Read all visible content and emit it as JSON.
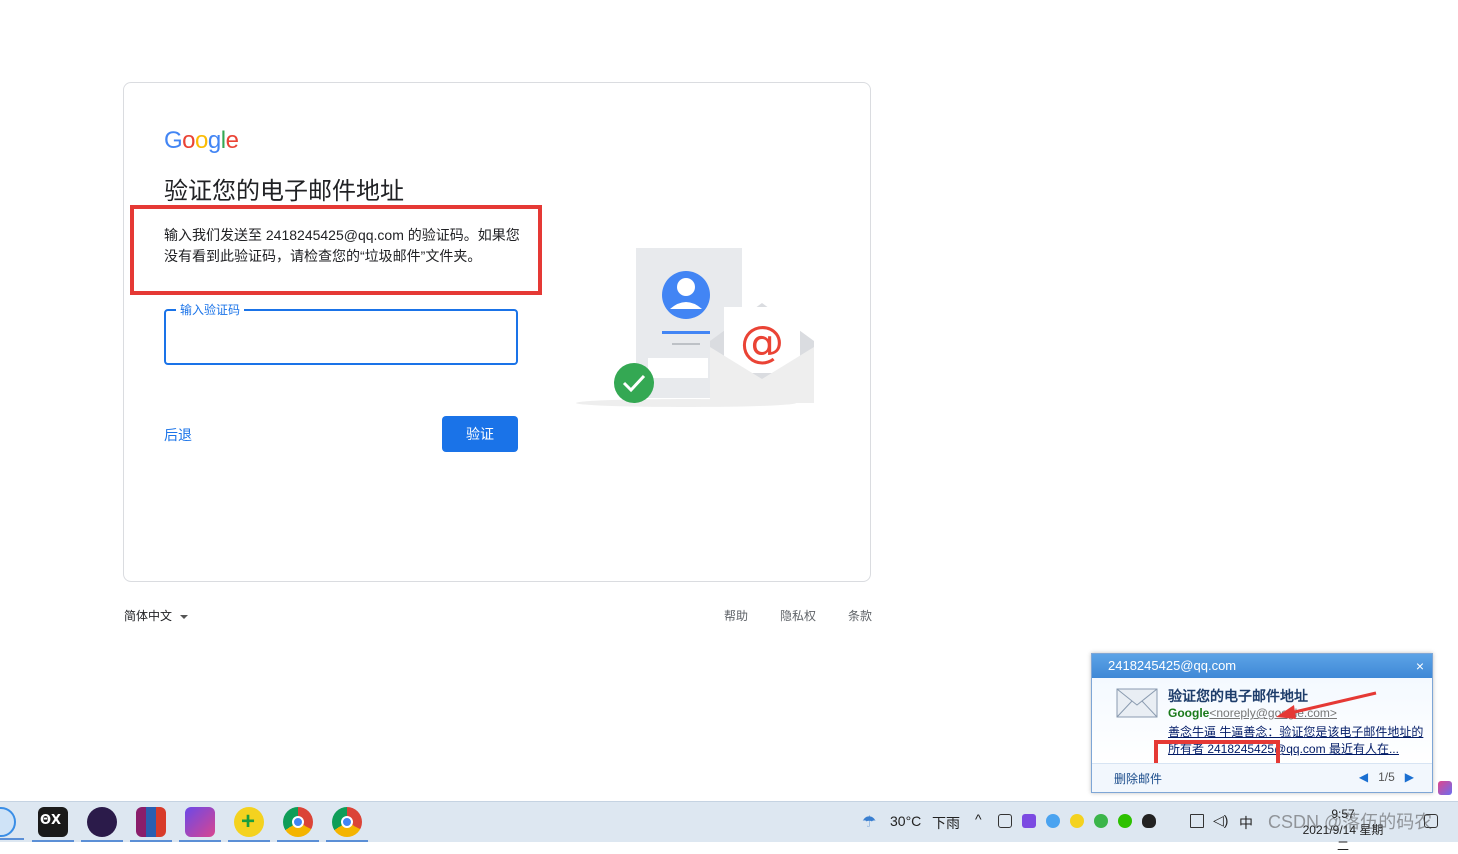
{
  "page": {
    "logo": [
      "G",
      "o",
      "o",
      "g",
      "l",
      "e"
    ],
    "logo_colors": [
      "#4285F4",
      "#EA4335",
      "#FBBC05",
      "#4285F4",
      "#34A853",
      "#EA4335"
    ],
    "title": "验证您的电子邮件地址",
    "description": "输入我们发送至 2418245425@qq.com 的验证码。如果您没有看到此验证码，请检查您的“垃圾邮件”文件夹。",
    "input_label": "输入验证码",
    "input_value": "",
    "back_label": "后退",
    "verify_label": "验证",
    "accent": "#1a73e8",
    "highlight_color": "#e53935"
  },
  "footer": {
    "language": "简体中文",
    "help": "帮助",
    "privacy": "隐私权",
    "terms": "条款"
  },
  "notification": {
    "account": "2418245425@qq.com",
    "subject": "验证您的电子邮件地址",
    "sender_name": "Google",
    "sender_email": "<noreply@google.com>",
    "preview": "善念牛逼 牛逼善念：验证您是该电子邮件地址的所有者 2418245425@qq.com 最近有人在...",
    "delete_label": "删除邮件",
    "pager": "1/5",
    "close_icon": "×"
  },
  "taskbar": {
    "weather": "30°C",
    "weather_desc": "下雨",
    "ime": "中",
    "time": "9:57",
    "date": "2021/9/14 星期二",
    "watermark": "CSDN @落伍的码农",
    "apps": [
      "baidu-netdisk-icon",
      "box-app-icon",
      "avatar-app-icon",
      "winrar-icon",
      "kugou-icon",
      "green-plus-icon",
      "chrome-icon",
      "chrome-icon"
    ]
  }
}
